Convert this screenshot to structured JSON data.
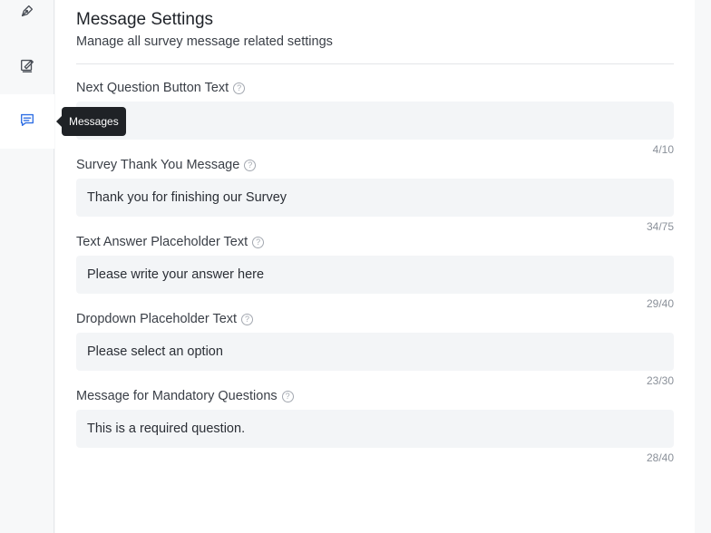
{
  "rail": {
    "items": [
      {
        "icon": "pen-icon"
      },
      {
        "icon": "design-icon"
      },
      {
        "icon": "message-icon",
        "active": true
      }
    ],
    "tooltip": "Messages"
  },
  "header": {
    "title": "Message Settings",
    "subtitle": "Manage all survey message related settings"
  },
  "fields": [
    {
      "label": "Next Question Button Text",
      "value": "",
      "count": "4/10"
    },
    {
      "label": "Survey Thank You Message",
      "value": "Thank you for finishing our Survey",
      "count": "34/75"
    },
    {
      "label": "Text Answer Placeholder Text",
      "value": "Please write your answer here",
      "count": "29/40"
    },
    {
      "label": "Dropdown Placeholder Text",
      "value": "Please select an option",
      "count": "23/30"
    },
    {
      "label": "Message for Mandatory Questions",
      "value": "This is a required question.",
      "count": "28/40"
    }
  ],
  "colors": {
    "accent": "#2f6fe4",
    "input_bg": "#f3f5f7",
    "tooltip_bg": "#1f2226"
  }
}
